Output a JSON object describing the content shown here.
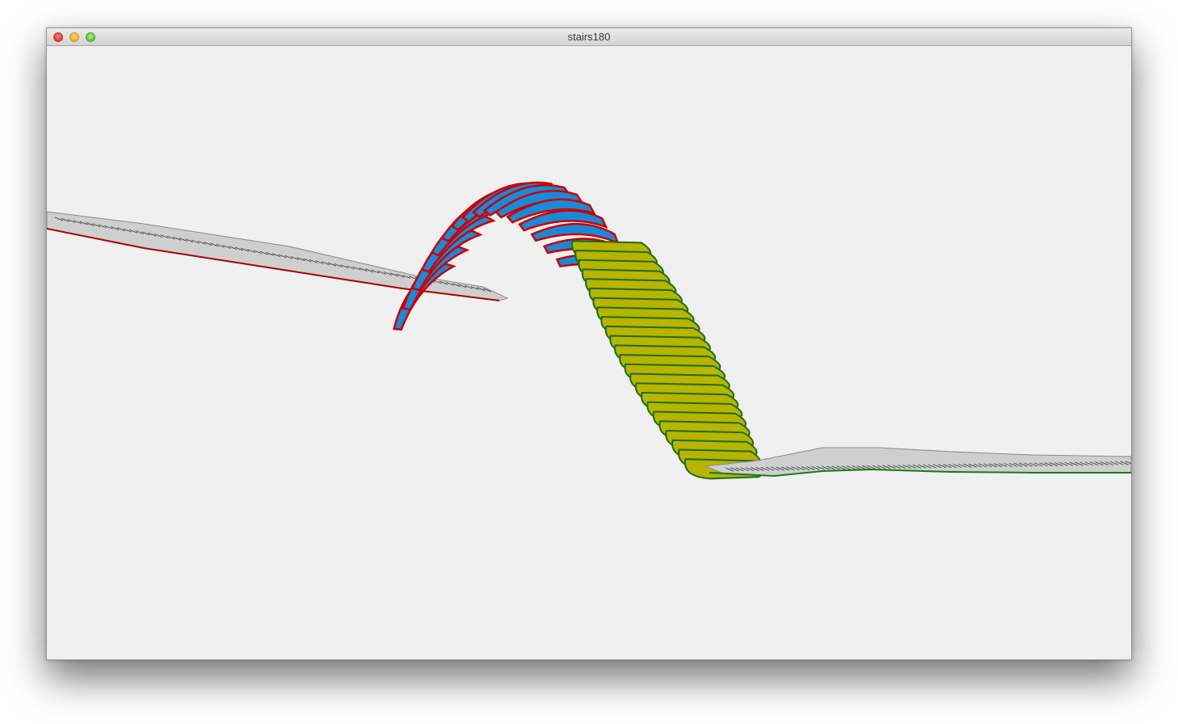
{
  "window": {
    "title": "stairs180"
  },
  "colors": {
    "background": "#f0f0f0",
    "rail": "#c0c0c0",
    "rail_edge_red": "#aa0000",
    "rail_edge_green": "#1a7a1a",
    "blue_treads": "#1a8ad8",
    "blue_tread_edge": "#cc0000",
    "yellow_treads": "#b8b400",
    "yellow_tread_edge": "#1a6e1a"
  },
  "icons": [
    "close-icon",
    "minimize-icon",
    "zoom-icon"
  ]
}
